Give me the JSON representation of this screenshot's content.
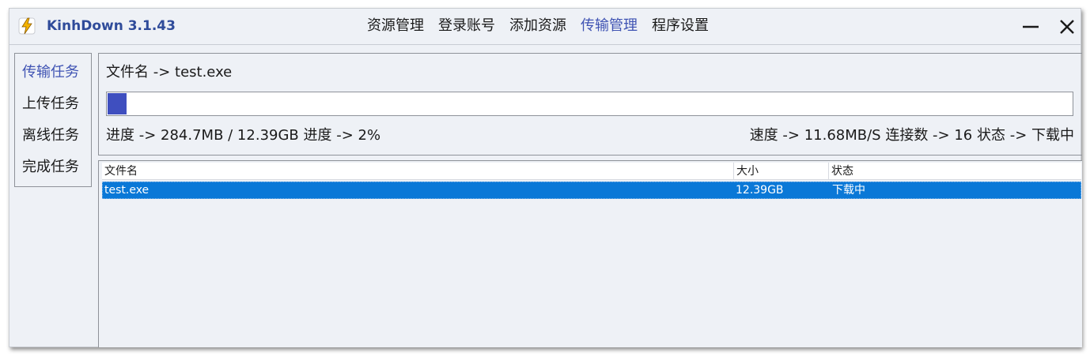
{
  "window": {
    "title": "KinhDown 3.1.43"
  },
  "menu": {
    "items": [
      {
        "label": "资源管理",
        "active": false
      },
      {
        "label": "登录账号",
        "active": false
      },
      {
        "label": "添加资源",
        "active": false
      },
      {
        "label": "传输管理",
        "active": true
      },
      {
        "label": "程序设置",
        "active": false
      }
    ]
  },
  "sidebar": {
    "items": [
      {
        "label": "传输任务",
        "active": true
      },
      {
        "label": "上传任务",
        "active": false
      },
      {
        "label": "离线任务",
        "active": false
      },
      {
        "label": "完成任务",
        "active": false
      }
    ]
  },
  "task": {
    "filename_line": "文件名 -> test.exe",
    "progress_line": "进度 -> 284.7MB / 12.39GB 进度 -> 2%",
    "status_line": "速度 -> 11.68MB/S 连接数 -> 16 状态 -> 下载中",
    "progress_fraction": 0.02
  },
  "table": {
    "columns": [
      "文件名",
      "大小",
      "状态"
    ],
    "rows": [
      {
        "name": "test.exe",
        "size": "12.39GB",
        "status": "下载中",
        "selected": true
      }
    ]
  },
  "colors": {
    "accent": "#3f53b3",
    "progress": "#3f4fbf",
    "selection": "#0a78d7",
    "window_bg": "#eef1f6",
    "title_text": "#2f4b9a"
  },
  "icons": {
    "app": "lightning-bolt-icon",
    "minimize": "minimize-icon",
    "close": "close-icon"
  }
}
